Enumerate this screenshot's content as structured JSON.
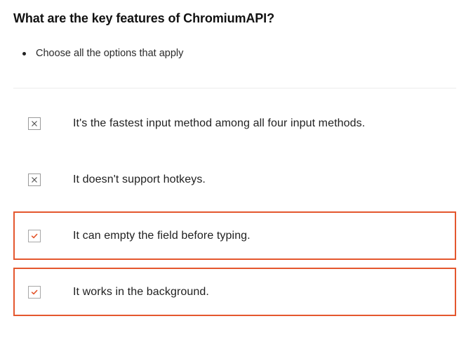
{
  "question": {
    "title": "What are the key features of ChromiumAPI?",
    "instruction": "Choose all the options that apply"
  },
  "colors": {
    "selected_border": "#e4572e",
    "check_mark": "#e4572e",
    "cross_mark": "#555555"
  },
  "options": [
    {
      "label": "It's the fastest input method among all four input methods.",
      "selected": false,
      "icon": "cross-icon"
    },
    {
      "label": "It doesn't support hotkeys.",
      "selected": false,
      "icon": "cross-icon"
    },
    {
      "label": "It can empty the field before typing.",
      "selected": true,
      "icon": "check-icon"
    },
    {
      "label": "It works in the background.",
      "selected": true,
      "icon": "check-icon"
    }
  ]
}
